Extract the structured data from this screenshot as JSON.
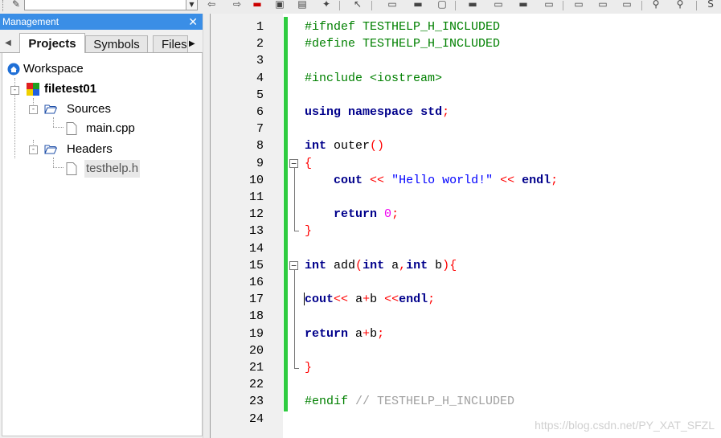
{
  "management": {
    "title": "Management",
    "close_glyph": "✕",
    "tabs": [
      {
        "label": "Projects",
        "active": true
      },
      {
        "label": "Symbols",
        "active": false
      },
      {
        "label": "Files",
        "active": false
      }
    ],
    "tree": {
      "workspace": "Workspace",
      "project": "filetest01",
      "sources_folder": "Sources",
      "source_file": "main.cpp",
      "headers_folder": "Headers",
      "header_file": "testhelp.h"
    }
  },
  "editor": {
    "line_numbers": [
      "1",
      "2",
      "3",
      "4",
      "5",
      "6",
      "7",
      "8",
      "9",
      "10",
      "11",
      "12",
      "13",
      "14",
      "15",
      "16",
      "17",
      "18",
      "19",
      "20",
      "21",
      "22",
      "23",
      "24"
    ],
    "lines": {
      "l1": "#ifndef TESTHELP_H_INCLUDED",
      "l2": "#define TESTHELP_H_INCLUDED",
      "l4": "#include <iostream>",
      "l6_kw1": "using",
      "l6_kw2": "namespace",
      "l6_id": "std",
      "l6_semi": ";",
      "l8_kw": "int",
      "l8_id": "outer",
      "l8_paren": "()",
      "l9_brace": "{",
      "l10_id": "cout",
      "l10_op1": "<<",
      "l10_str": "\"Hello world!\"",
      "l10_op2": "<<",
      "l10_endl": "endl",
      "l10_semi": ";",
      "l12_kw": "return",
      "l12_num": "0",
      "l12_semi": ";",
      "l13_brace": "}",
      "l15_kw": "int",
      "l15_id": "add",
      "l15_p1": "(",
      "l15_kw2": "int",
      "l15_a": "a",
      "l15_comma": ",",
      "l15_kw3": "int",
      "l15_b": "b",
      "l15_p2": ")",
      "l15_brace": "{",
      "l17_c": "c",
      "l17_out": "out",
      "l17_op1": "<<",
      "l17_a": "a",
      "l17_plus": "+",
      "l17_b": "b",
      "l17_op2": "<<",
      "l17_endl": "endl",
      "l17_semi": ";",
      "l19_kw": "return",
      "l19_a": "a",
      "l19_plus": "+",
      "l19_b": "b",
      "l19_semi": ";",
      "l21_brace": "}",
      "l23_pp": "#endif",
      "l23_cm": "// TESTHELP_H_INCLUDED"
    }
  },
  "watermark": "https://blog.csdn.net/PY_XAT_SFZL",
  "colors": {
    "title_bar": "#3a8ee6",
    "preprocessor": "#008000",
    "keyword": "#00008b",
    "operator": "#ff0000",
    "string": "#0000ff",
    "number": "#f000f0",
    "comment": "#a0a0a0",
    "change_bar": "#2ecc40"
  }
}
